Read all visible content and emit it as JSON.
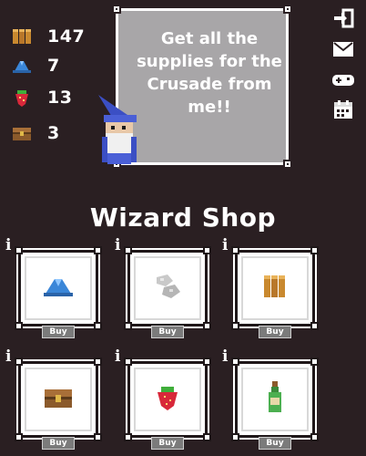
{
  "resources": [
    {
      "icon": "wood-logs-icon",
      "value": "147"
    },
    {
      "icon": "blue-crystal-icon",
      "value": "7"
    },
    {
      "icon": "strawberry-icon",
      "value": "13"
    },
    {
      "icon": "treasure-chest-icon",
      "value": "3"
    }
  ],
  "dialog": {
    "text": "Get all the supplies for the Crusade from me!!"
  },
  "menu_icons": [
    "exit-icon",
    "mail-icon",
    "gamepad-icon",
    "calendar-icon"
  ],
  "shop": {
    "title": "Wizard Shop",
    "info_label": "i",
    "buy_label": "Buy",
    "items": [
      {
        "icon": "blue-crystal-icon"
      },
      {
        "icon": "stone-icon"
      },
      {
        "icon": "wood-logs-icon"
      },
      {
        "icon": "treasure-chest-icon"
      },
      {
        "icon": "strawberry-icon"
      },
      {
        "icon": "potion-bottle-icon"
      }
    ]
  },
  "colors": {
    "background": "#2a1f22",
    "dialog": "#a8a6a8",
    "buy_button": "#7b7b7b"
  }
}
